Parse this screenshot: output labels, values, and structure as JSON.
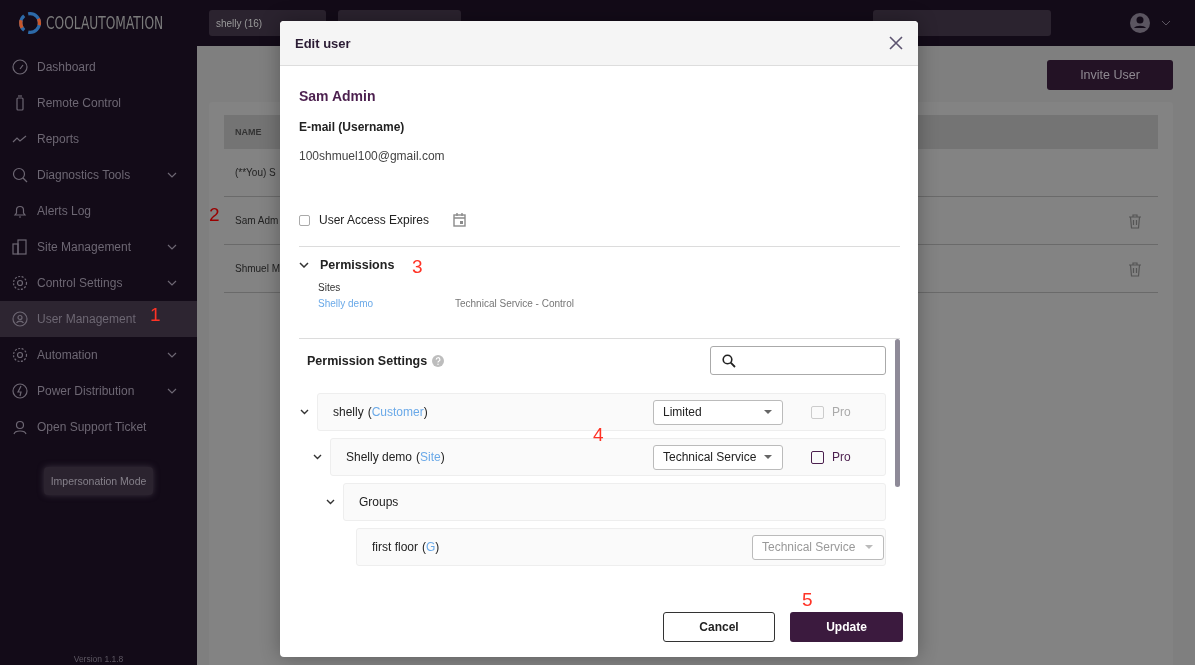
{
  "brand": {
    "logo_text": "COOLAUTOMATION"
  },
  "top_bar": {
    "customer_select": "shelly (16)"
  },
  "sidebar": {
    "items": [
      {
        "label": "Dashboard",
        "expandable": false,
        "selected": false
      },
      {
        "label": "Remote Control",
        "expandable": false,
        "selected": false
      },
      {
        "label": "Reports",
        "expandable": false,
        "selected": false
      },
      {
        "label": "Diagnostics Tools",
        "expandable": true,
        "selected": false
      },
      {
        "label": "Alerts Log",
        "expandable": false,
        "selected": false
      },
      {
        "label": "Site Management",
        "expandable": true,
        "selected": false
      },
      {
        "label": "Control Settings",
        "expandable": true,
        "selected": false
      },
      {
        "label": "User Management",
        "expandable": false,
        "selected": true
      },
      {
        "label": "Automation",
        "expandable": true,
        "selected": false
      },
      {
        "label": "Power Distribution",
        "expandable": true,
        "selected": false
      },
      {
        "label": "Open Support Ticket",
        "expandable": false,
        "selected": false
      }
    ],
    "impersonation_button": "Impersonation Mode",
    "version": "Version 1.1.8"
  },
  "main": {
    "invite_button": "Invite User",
    "table": {
      "columns": [
        "NAME"
      ],
      "rows": [
        {
          "name": "(**You) S",
          "deletable": false
        },
        {
          "name": "Sam Adm",
          "deletable": true
        },
        {
          "name": "Shmuel M",
          "deletable": true
        }
      ]
    }
  },
  "dialog": {
    "title": "Edit user",
    "user_name": "Sam Admin",
    "email_label": "E-mail (Username)",
    "email": "100shmuel100@gmail.com",
    "access_expires": {
      "label": "User Access Expires",
      "checked": false
    },
    "permissions": {
      "title": "Permissions",
      "expanded": true,
      "sites_label": "Sites",
      "sites": [
        {
          "name": "Shelly demo",
          "role": "Technical Service - Control"
        }
      ]
    },
    "permission_settings": {
      "title": "Permission Settings",
      "tree": [
        {
          "name": "shelly",
          "type": "(Customer)",
          "expanded": true,
          "role": {
            "value": "Limited",
            "disabled": false
          },
          "pro": {
            "label": "Pro",
            "checked": false,
            "disabled": true
          },
          "children": [
            {
              "name": "Shelly demo",
              "type": "(Site)",
              "expanded": true,
              "role": {
                "value": "Technical Service",
                "disabled": false
              },
              "pro": {
                "label": "Pro",
                "checked": false,
                "disabled": false
              },
              "children": [
                {
                  "name": "Groups",
                  "expanded": true,
                  "children": [
                    {
                      "name": "first floor",
                      "type": "(G)",
                      "role": {
                        "value": "Technical Service",
                        "disabled": true
                      }
                    }
                  ]
                }
              ]
            }
          ]
        }
      ]
    },
    "buttons": {
      "cancel": "Cancel",
      "update": "Update"
    }
  },
  "annotations": [
    "1",
    "2",
    "3",
    "4",
    "5"
  ]
}
